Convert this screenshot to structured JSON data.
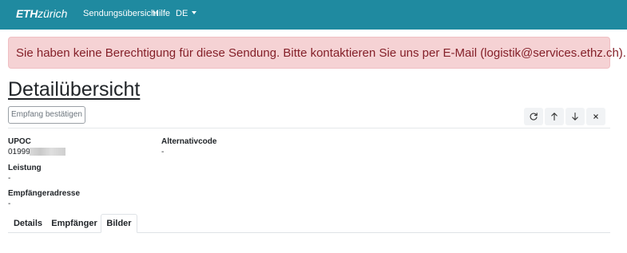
{
  "navbar": {
    "logo_eth": "ETH",
    "logo_zurich": "zürich",
    "links": [
      {
        "label": "Sendungsübersicht"
      },
      {
        "label": "Hilfe"
      }
    ],
    "language": "DE",
    "color": "#1f8aa0"
  },
  "alert": {
    "message": "Sie haben keine Berechtigung für diese Sendung. Bitte kontaktieren Sie uns per E-Mail (logistik@services.ethz.ch).",
    "color": "#f5d2d4",
    "text_color": "#842029"
  },
  "page": {
    "title": "Detailübersicht"
  },
  "toolbar": {
    "confirm_label": "Empfang bestätigen",
    "icons": [
      "refresh-icon",
      "arrow-up-icon",
      "arrow-down-icon",
      "close-icon"
    ]
  },
  "details": {
    "upoc_label": "UPOC",
    "upoc_value": "01999",
    "alternativcode_label": "Alternativcode",
    "alternativcode_value": "-",
    "leistung_label": "Leistung",
    "leistung_value": "-",
    "empfaengeradresse_label": "Empfängeradresse",
    "empfaengeradresse_value": "-"
  },
  "tabs": [
    {
      "label": "Details",
      "active": false
    },
    {
      "label": "Empfänger",
      "active": false
    },
    {
      "label": "Bilder",
      "active": true
    }
  ]
}
